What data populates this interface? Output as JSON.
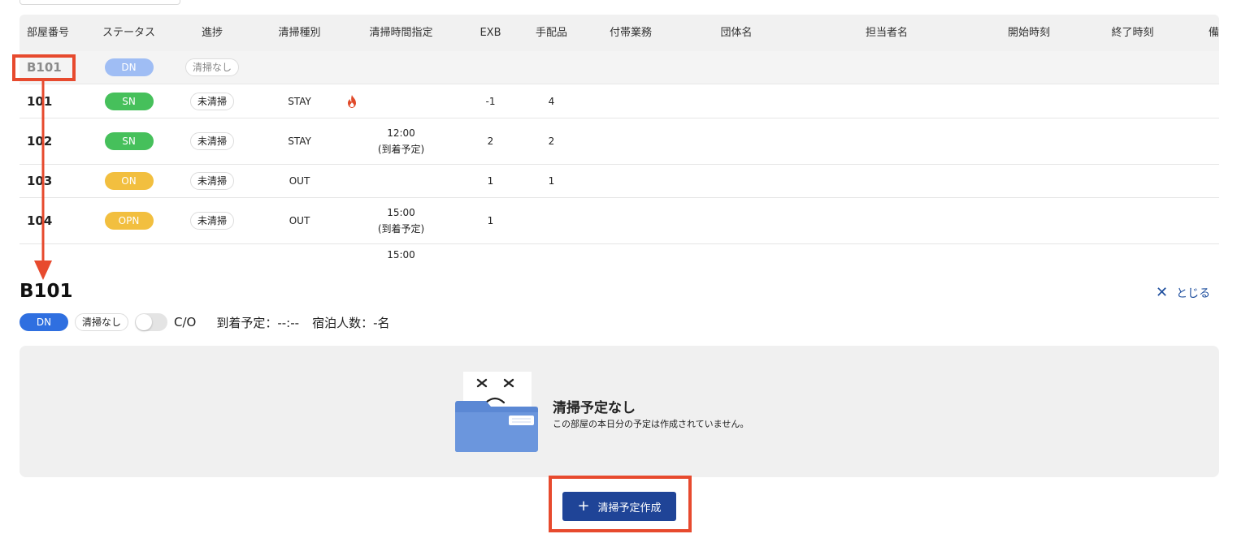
{
  "table": {
    "headers": {
      "room": "部屋番号",
      "status": "ステータス",
      "progress": "進捗",
      "type": "清掃種別",
      "time": "清掃時間指定",
      "exb": "EXB",
      "items": "手配品",
      "extra": "付帯業務",
      "group": "団体名",
      "person": "担当者名",
      "start": "開始時刻",
      "end": "終了時刻",
      "note": "備考"
    },
    "rows": [
      {
        "room": "B101",
        "status": "DN",
        "progress": "清掃なし",
        "type": "",
        "time1": "",
        "time2": "",
        "exb": "",
        "items": ""
      },
      {
        "room": "101",
        "status": "SN",
        "progress": "未清掃",
        "type": "STAY",
        "time1": "",
        "time2": "",
        "exb": "-1",
        "items": "4"
      },
      {
        "room": "102",
        "status": "SN",
        "progress": "未清掃",
        "type": "STAY",
        "time1": "12:00",
        "time2": "(到着予定)",
        "exb": "2",
        "items": "2"
      },
      {
        "room": "103",
        "status": "ON",
        "progress": "未清掃",
        "type": "OUT",
        "time1": "",
        "time2": "",
        "exb": "1",
        "items": "1"
      },
      {
        "room": "104",
        "status": "OPN",
        "progress": "未清掃",
        "type": "OUT",
        "time1": "15:00",
        "time2": "(到着予定)",
        "exb": "1",
        "items": ""
      }
    ],
    "partial_time": "15:00"
  },
  "detail": {
    "title": "B101",
    "close_label": "とじる",
    "close_icon": "close-icon",
    "status": "DN",
    "progress": "清掃なし",
    "co_label": "C/O",
    "arrival": "到着予定：--:--",
    "guests": "宿泊人数：-名",
    "co_toggle_on": false
  },
  "empty": {
    "title": "清掃予定なし",
    "description": "この部屋の本日分の予定は作成されていません。",
    "icon": "empty-folder-icon"
  },
  "create_button": {
    "label": "清掃予定作成",
    "icon": "plus-icon"
  },
  "colors": {
    "primary": "#1f4497",
    "dn": "#2f6fe0",
    "sn": "#46c05b",
    "on": "#f2bf3f",
    "highlight": "#e74a2e"
  }
}
